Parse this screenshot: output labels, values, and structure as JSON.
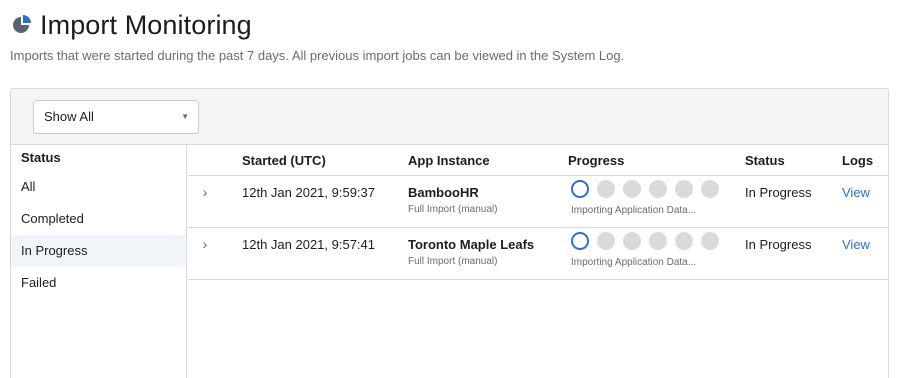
{
  "page": {
    "title": "Import Monitoring",
    "icon": "pie-chart-icon",
    "subtitle": "Imports that were started during the past 7 days. All previous import jobs can be viewed in the System Log."
  },
  "filter": {
    "selected": "Show All"
  },
  "sidebar": {
    "header": "Status",
    "items": [
      {
        "label": "All"
      },
      {
        "label": "Completed"
      },
      {
        "label": "In Progress"
      },
      {
        "label": "Failed"
      }
    ],
    "active_index": 2
  },
  "table": {
    "columns": {
      "started": "Started (UTC)",
      "app": "App Instance",
      "progress": "Progress",
      "status": "Status",
      "logs": "Logs"
    },
    "rows": [
      {
        "started": "12th Jan 2021, 9:59:37",
        "app_name": "BambooHR",
        "app_sub": "Full Import (manual)",
        "progress_steps": 6,
        "progress_current_step": 1,
        "progress_label": "Importing Application Data...",
        "status": "In Progress",
        "logs": "View"
      },
      {
        "started": "12th Jan 2021, 9:57:41",
        "app_name": "Toronto Maple Leafs",
        "app_sub": "Full Import (manual)",
        "progress_steps": 6,
        "progress_current_step": 1,
        "progress_label": "Importing Application Data...",
        "status": "In Progress",
        "logs": "View"
      }
    ]
  },
  "colors": {
    "accent": "#2f6fca",
    "icon": "#5a6173",
    "inactive_step": "#d9dadd"
  }
}
